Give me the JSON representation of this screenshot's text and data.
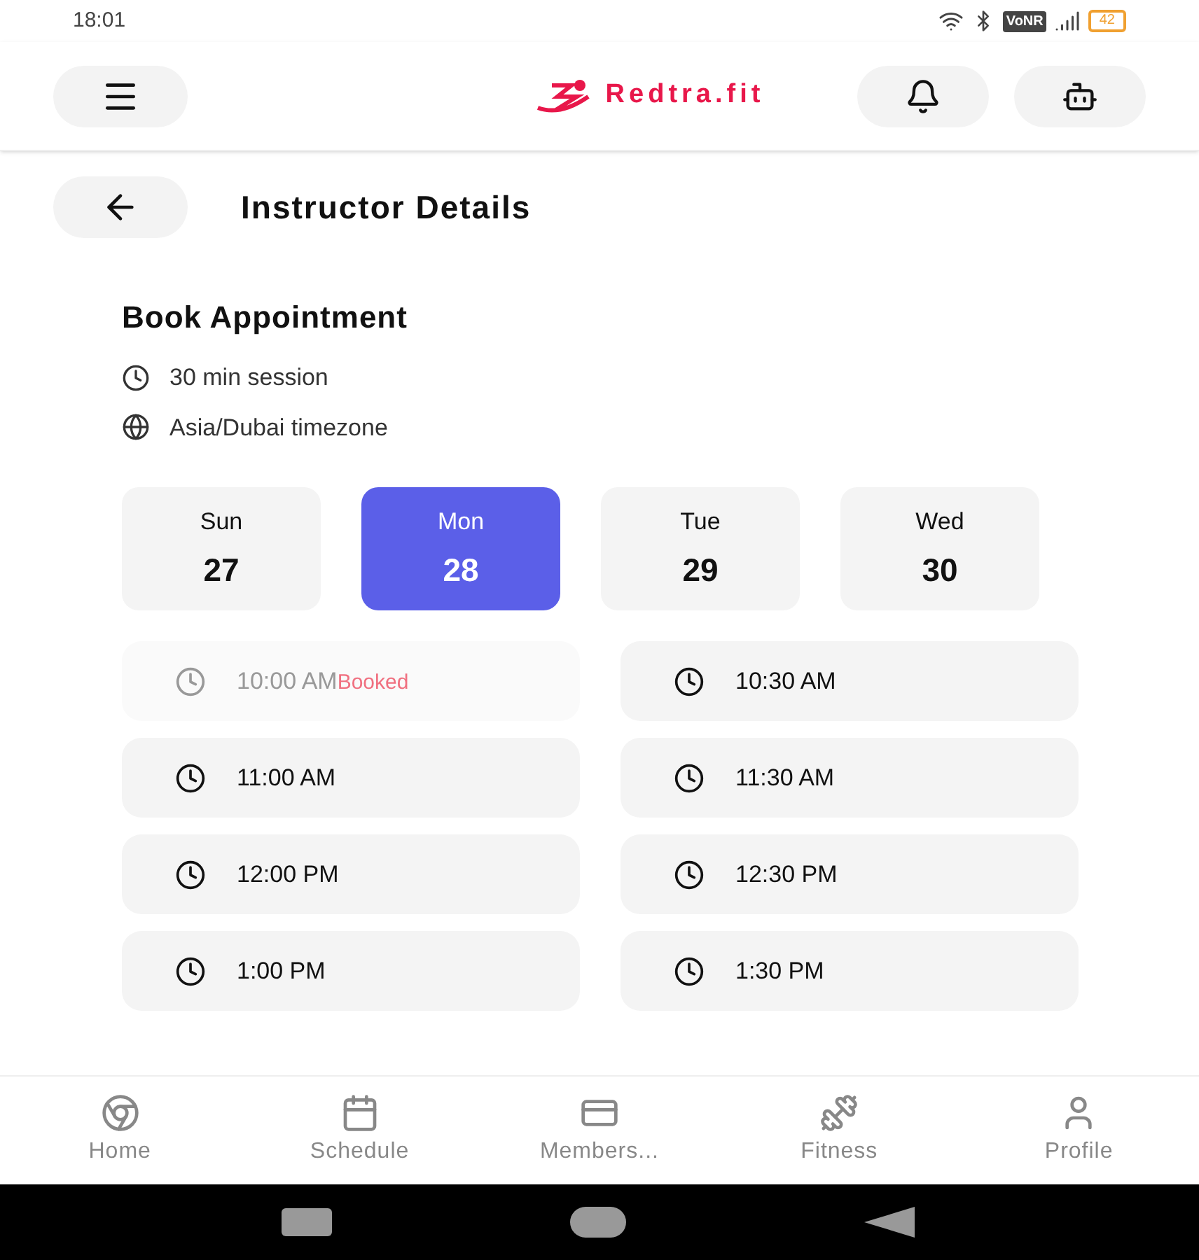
{
  "status_bar": {
    "time": "18:01",
    "network_badge": "VoNR",
    "battery": "42"
  },
  "header": {
    "logo_text": "Redtra.fit"
  },
  "page": {
    "title": "Instructor Details"
  },
  "booking": {
    "title": "Book Appointment",
    "duration": "30 min session",
    "timezone": "Asia/Dubai timezone",
    "days": [
      {
        "weekday": "Sun",
        "date": "27",
        "selected": false
      },
      {
        "weekday": "Mon",
        "date": "28",
        "selected": true
      },
      {
        "weekday": "Tue",
        "date": "29",
        "selected": false
      },
      {
        "weekday": "Wed",
        "date": "30",
        "selected": false
      }
    ],
    "slots": [
      {
        "time": "10:00 AM",
        "booked": true,
        "status": "Booked"
      },
      {
        "time": "10:30 AM",
        "booked": false
      },
      {
        "time": "11:00 AM",
        "booked": false
      },
      {
        "time": "11:30 AM",
        "booked": false
      },
      {
        "time": "12:00 PM",
        "booked": false
      },
      {
        "time": "12:30 PM",
        "booked": false
      },
      {
        "time": "1:00 PM",
        "booked": false
      },
      {
        "time": "1:30 PM",
        "booked": false
      }
    ]
  },
  "bottom_nav": [
    {
      "kind": "home",
      "label": "Home"
    },
    {
      "kind": "schedule",
      "label": "Schedule"
    },
    {
      "kind": "membership",
      "label": "Members..."
    },
    {
      "kind": "fitness",
      "label": "Fitness"
    },
    {
      "kind": "profile",
      "label": "Profile"
    }
  ]
}
